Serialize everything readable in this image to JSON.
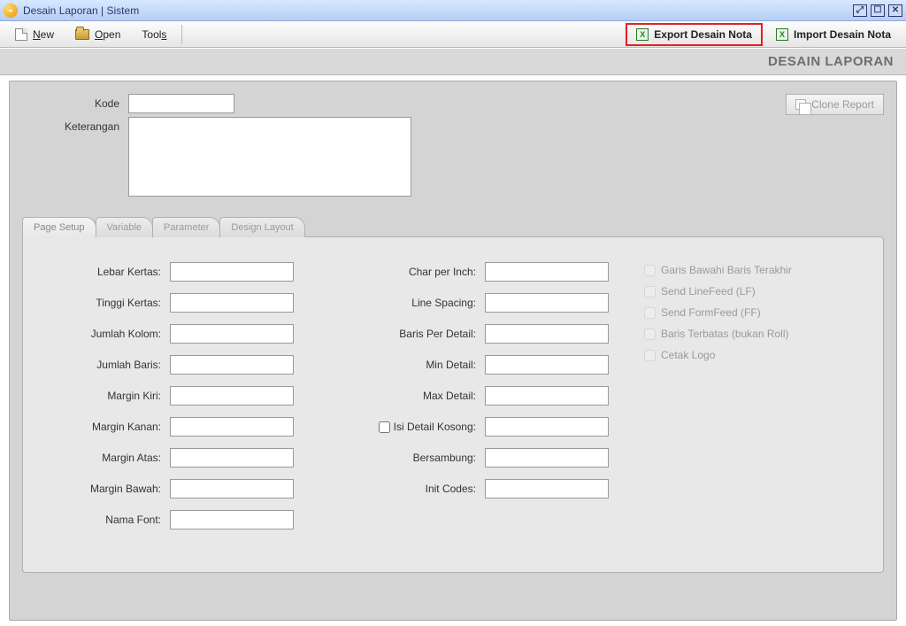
{
  "window": {
    "title": "Desain Laporan | Sistem"
  },
  "toolbar": {
    "new_label": "ew",
    "new_prefix": "N",
    "open_label": "pen",
    "open_prefix": "O",
    "tools_label": "s",
    "tools_prefix": "Tool",
    "export_label": "Export Desain Nota",
    "import_label": "Import Desain Nota"
  },
  "header": {
    "caption": "DESAIN LAPORAN"
  },
  "form": {
    "kode_label": "Kode",
    "keterangan_label": "Keterangan",
    "kode_value": "",
    "keterangan_value": "",
    "clone_label": "Clone Report"
  },
  "tabs": {
    "page_setup": "Page Setup",
    "variable": "Variable",
    "parameter": "Parameter",
    "design_layout": "Design Layout"
  },
  "page_setup": {
    "lebar_kertas": "Lebar Kertas:",
    "tinggi_kertas": "Tinggi Kertas:",
    "jumlah_kolom": "Jumlah Kolom:",
    "jumlah_baris": "Jumlah Baris:",
    "margin_kiri": "Margin Kiri:",
    "margin_kanan": "Margin Kanan:",
    "margin_atas": "Margin Atas:",
    "margin_bawah": "Margin Bawah:",
    "nama_font": "Nama Font:",
    "char_per_inch": "Char per Inch:",
    "line_spacing": "Line Spacing:",
    "baris_per_detail": "Baris Per Detail:",
    "min_detail": "Min Detail:",
    "max_detail": "Max Detail:",
    "isi_detail_kosong": "Isi Detail Kosong:",
    "bersambung": "Bersambung:",
    "init_codes": "Init Codes:",
    "values": {
      "lebar_kertas": "",
      "tinggi_kertas": "",
      "jumlah_kolom": "",
      "jumlah_baris": "",
      "margin_kiri": "",
      "margin_kanan": "",
      "margin_atas": "",
      "margin_bawah": "",
      "nama_font": "",
      "char_per_inch": "",
      "line_spacing": "",
      "baris_per_detail": "",
      "min_detail": "",
      "max_detail": "",
      "isi_detail_kosong": "",
      "bersambung": "",
      "init_codes": ""
    }
  },
  "checks": {
    "garis_bawahi": "Garis Bawahi Baris Terakhir",
    "send_lf": "Send LineFeed (LF)",
    "send_ff": "Send FormFeed (FF)",
    "baris_terbatas": "Baris Terbatas (bukan Roll)",
    "cetak_logo": "Cetak Logo"
  }
}
